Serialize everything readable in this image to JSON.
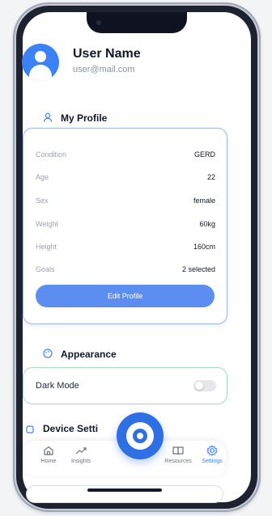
{
  "header": {
    "name": "User Name",
    "email": "user@mail.com"
  },
  "sections": {
    "profile_title": "My Profile",
    "appearance_title": "Appearance",
    "device_title": "Device Setti"
  },
  "profile": {
    "rows": [
      {
        "label": "Condition",
        "value": "GERD"
      },
      {
        "label": "Age",
        "value": "22"
      },
      {
        "label": "Sex",
        "value": "female"
      },
      {
        "label": "Weight",
        "value": "60kg"
      },
      {
        "label": "Height",
        "value": "160cm"
      },
      {
        "label": "Goals",
        "value": "2 selected"
      }
    ],
    "edit_button": "Edit Profile"
  },
  "appearance": {
    "dark_mode_label": "Dark Mode",
    "dark_mode_on": false
  },
  "nav": {
    "items": [
      {
        "label": "Home",
        "icon": "home-icon"
      },
      {
        "label": "Insights",
        "icon": "insights-icon"
      },
      {
        "label": "Resources",
        "icon": "resources-icon"
      },
      {
        "label": "Settings",
        "icon": "settings-icon"
      }
    ],
    "active": "Settings"
  },
  "colors": {
    "accent": "#3b82f6",
    "button": "#5b8ef0",
    "profile_border": "#9db5e6",
    "appearance_border": "#a3d9b8"
  }
}
